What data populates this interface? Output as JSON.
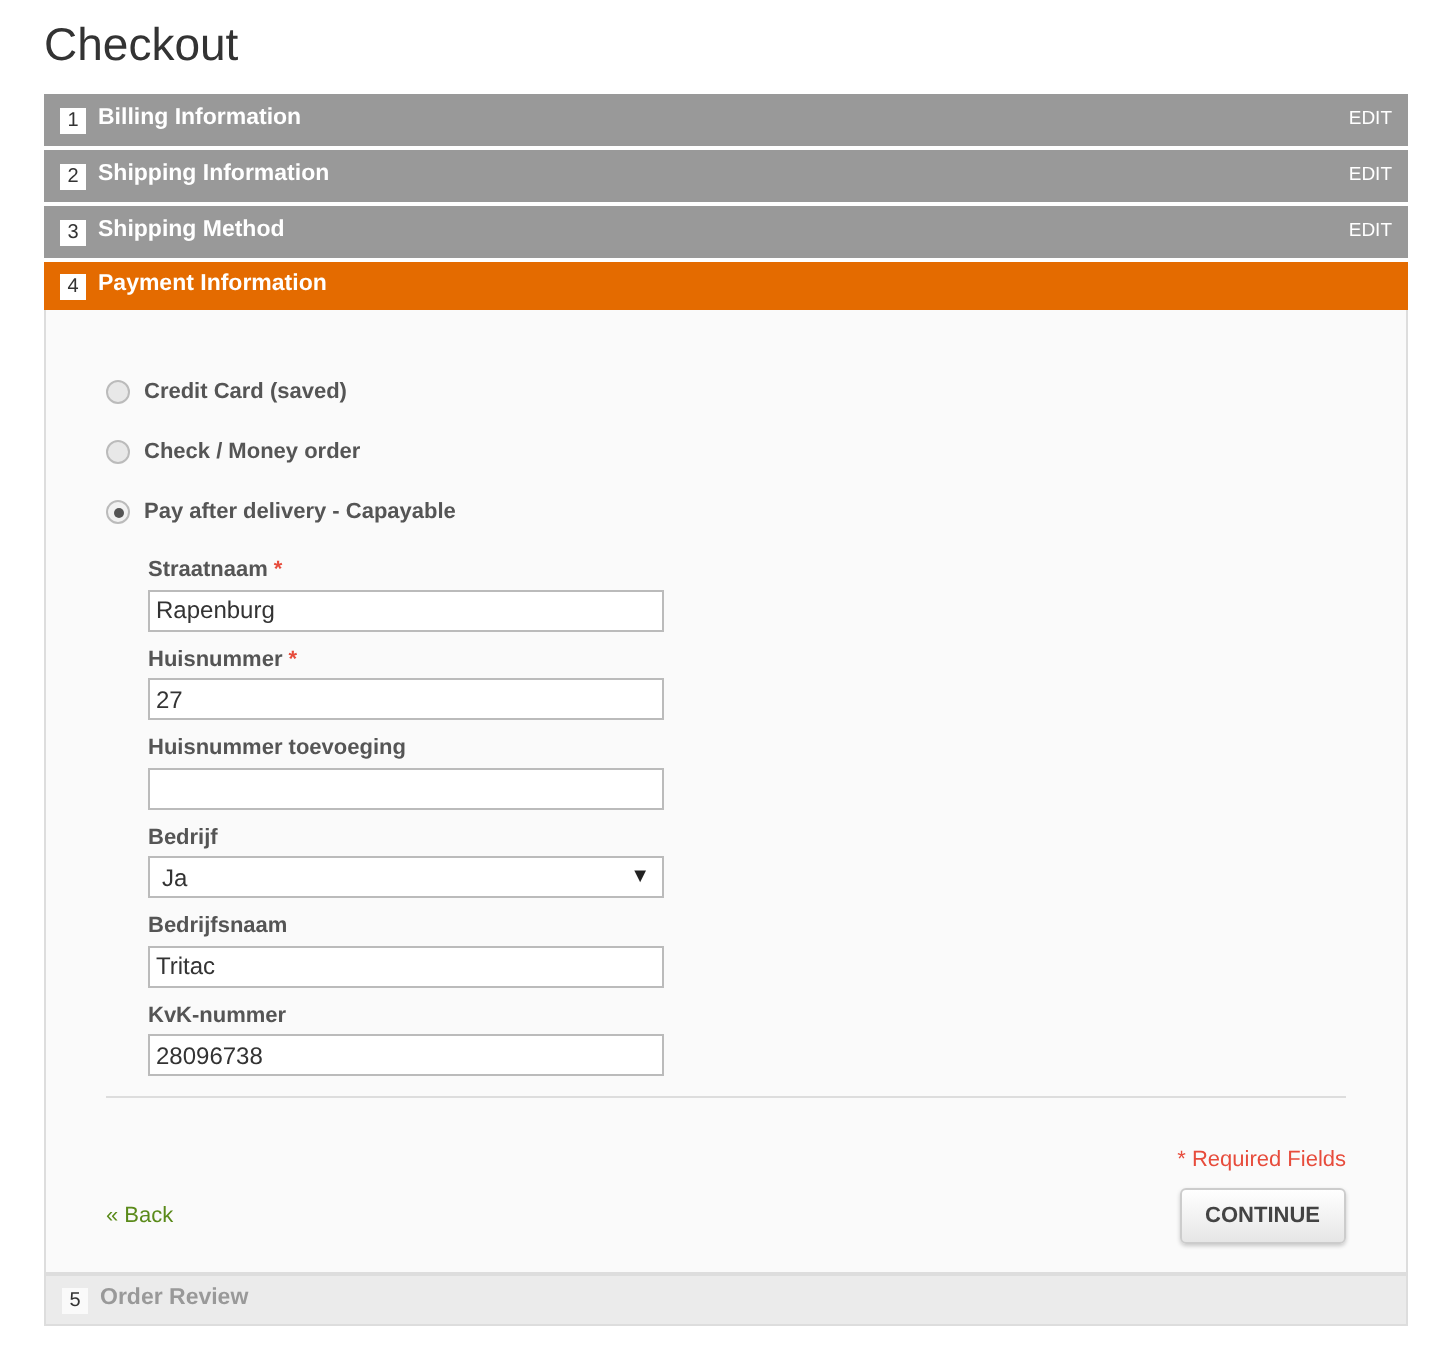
{
  "title": "Checkout",
  "steps": [
    {
      "number": "1",
      "label": "Billing Information",
      "kind": "done",
      "action": "EDIT"
    },
    {
      "number": "2",
      "label": "Shipping Information",
      "kind": "done",
      "action": "EDIT"
    },
    {
      "number": "3",
      "label": "Shipping Method",
      "kind": "done",
      "action": "EDIT"
    },
    {
      "number": "4",
      "label": "Payment Information",
      "kind": "active"
    },
    {
      "number": "5",
      "label": "Order Review",
      "kind": "pending"
    }
  ],
  "payment_methods": [
    {
      "label": "Credit Card (saved)",
      "selected": false
    },
    {
      "label": "Check / Money order",
      "selected": false
    },
    {
      "label": "Pay after delivery - Capayable",
      "selected": true
    }
  ],
  "fields": [
    {
      "kind": "text",
      "label": "Straatnaam",
      "required_marker": "*",
      "value": "Rapenburg"
    },
    {
      "kind": "text",
      "label": "Huisnummer",
      "required_marker": "*",
      "value": "27"
    },
    {
      "kind": "text",
      "label": "Huisnummer toevoeging"
    },
    {
      "kind": "select",
      "label": "Bedrijf",
      "value": "Ja"
    },
    {
      "kind": "text",
      "label": "Bedrijfsnaam",
      "value": "Tritac"
    },
    {
      "kind": "text",
      "label": "KvK-nummer",
      "value": "28096738"
    }
  ],
  "required_note": "* Required Fields",
  "back_link": "« Back",
  "continue_button": "CONTINUE",
  "select_arrow": "▼"
}
